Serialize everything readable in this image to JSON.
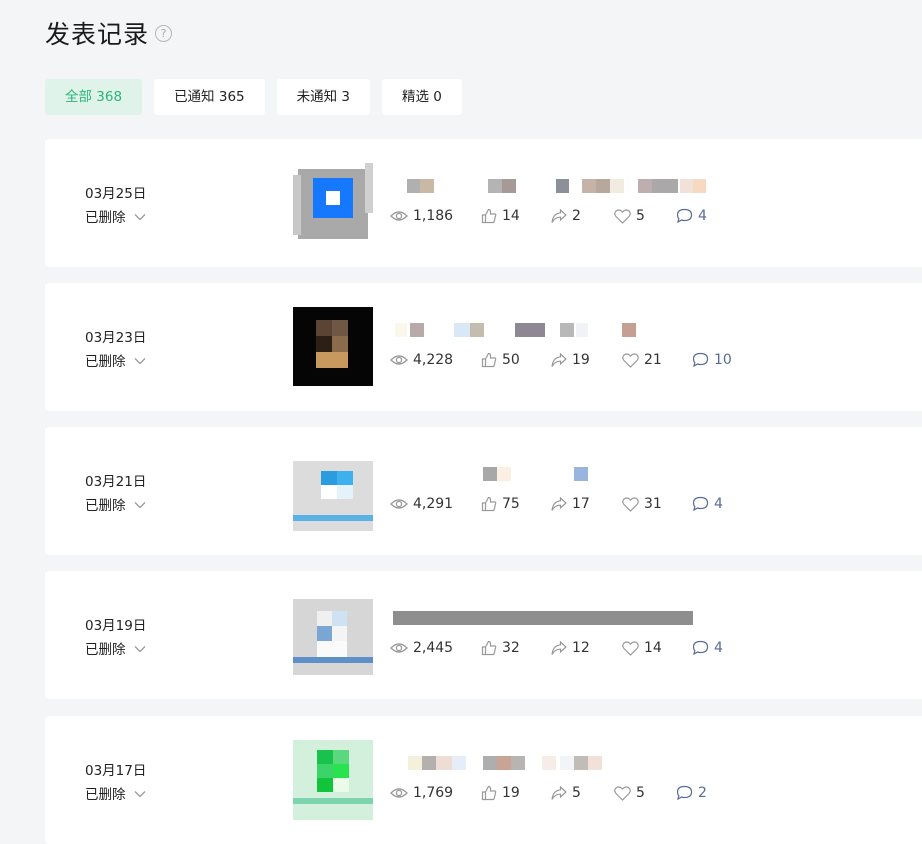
{
  "page": {
    "title": "发表记录",
    "help_glyph": "?"
  },
  "tabs": [
    {
      "label": "全部 368",
      "active": true
    },
    {
      "label": "已通知 365",
      "active": false
    },
    {
      "label": "未通知 3",
      "active": false
    },
    {
      "label": "精选 0",
      "active": false
    }
  ],
  "posts": [
    {
      "date": "03月25日",
      "status": "已删除",
      "views": "1,186",
      "likes": "14",
      "shares": "2",
      "favorites": "5",
      "comments": "4"
    },
    {
      "date": "03月23日",
      "status": "已删除",
      "views": "4,228",
      "likes": "50",
      "shares": "19",
      "favorites": "21",
      "comments": "10"
    },
    {
      "date": "03月21日",
      "status": "已删除",
      "views": "4,291",
      "likes": "75",
      "shares": "17",
      "favorites": "31",
      "comments": "4"
    },
    {
      "date": "03月19日",
      "status": "已删除",
      "views": "2,445",
      "likes": "32",
      "shares": "12",
      "favorites": "14",
      "comments": "4"
    },
    {
      "date": "03月17日",
      "status": "已删除",
      "views": "1,769",
      "likes": "19",
      "shares": "5",
      "favorites": "5",
      "comments": "2"
    }
  ],
  "colors": {
    "accent": "#2cb57a",
    "active_tab_bg": "#dff3ea",
    "comment": "#576b95",
    "page_bg": "#f4f5f7"
  },
  "icons": [
    "help-icon",
    "chevron-down-icon",
    "eye-icon",
    "thumbs-up-icon",
    "share-icon",
    "heart-icon",
    "comment-icon"
  ]
}
